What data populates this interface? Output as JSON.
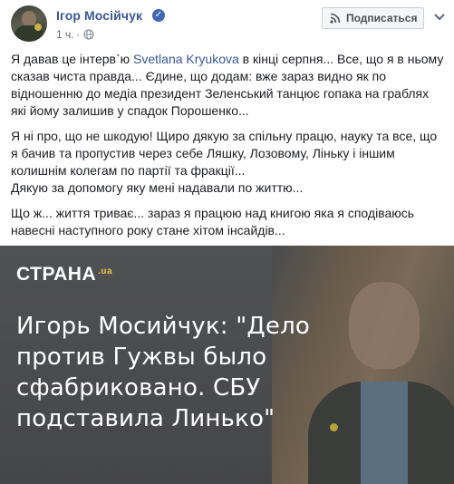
{
  "author": {
    "name": "Ігор Мосійчук",
    "verified": true,
    "timestamp": "1 ч.",
    "separator": "·",
    "privacy_icon": "globe-icon"
  },
  "header": {
    "subscribe_label": "Подписаться",
    "subscribe_icon": "rss-icon",
    "more_icon": "chevron-down-icon"
  },
  "post": {
    "p1_a": "Я давав це інтерв`ю ",
    "p1_mention": "Svetlana Kryukova",
    "p1_b": " в кінці серпня... Все, що я в ньому сказав чиста правда... Єдине, що додам: вже зараз видно як по відношенню до медіа президент Зеленський танцює гопака на граблях які йому залишив у спадок Порошенко...",
    "p2": "Я ні про, що не шкодую! Щиро дякую за спільну працю, науку та все, що я бачив та пропустив через себе Ляшку, Лозовому, Ліньку і іншим колишнім колегам по партії та фракції...",
    "p2b": "Дякую за допомогу яку мені надавали по життю...",
    "p3": "Що ж... життя триває... зараз я працюю над книгою яка я сподіваюсь навесні наступного року стане хітом інсайдів..."
  },
  "link_card": {
    "brand": "СТРАНА",
    "brand_suffix": ".ua",
    "headline": "Игорь Мосийчук: \"Дело против Гужвы было сфабриковано. СБУ подставила Линько\""
  },
  "colors": {
    "link": "#385898",
    "verified": "#4267b2",
    "brand_accent": "#e9c84a"
  }
}
